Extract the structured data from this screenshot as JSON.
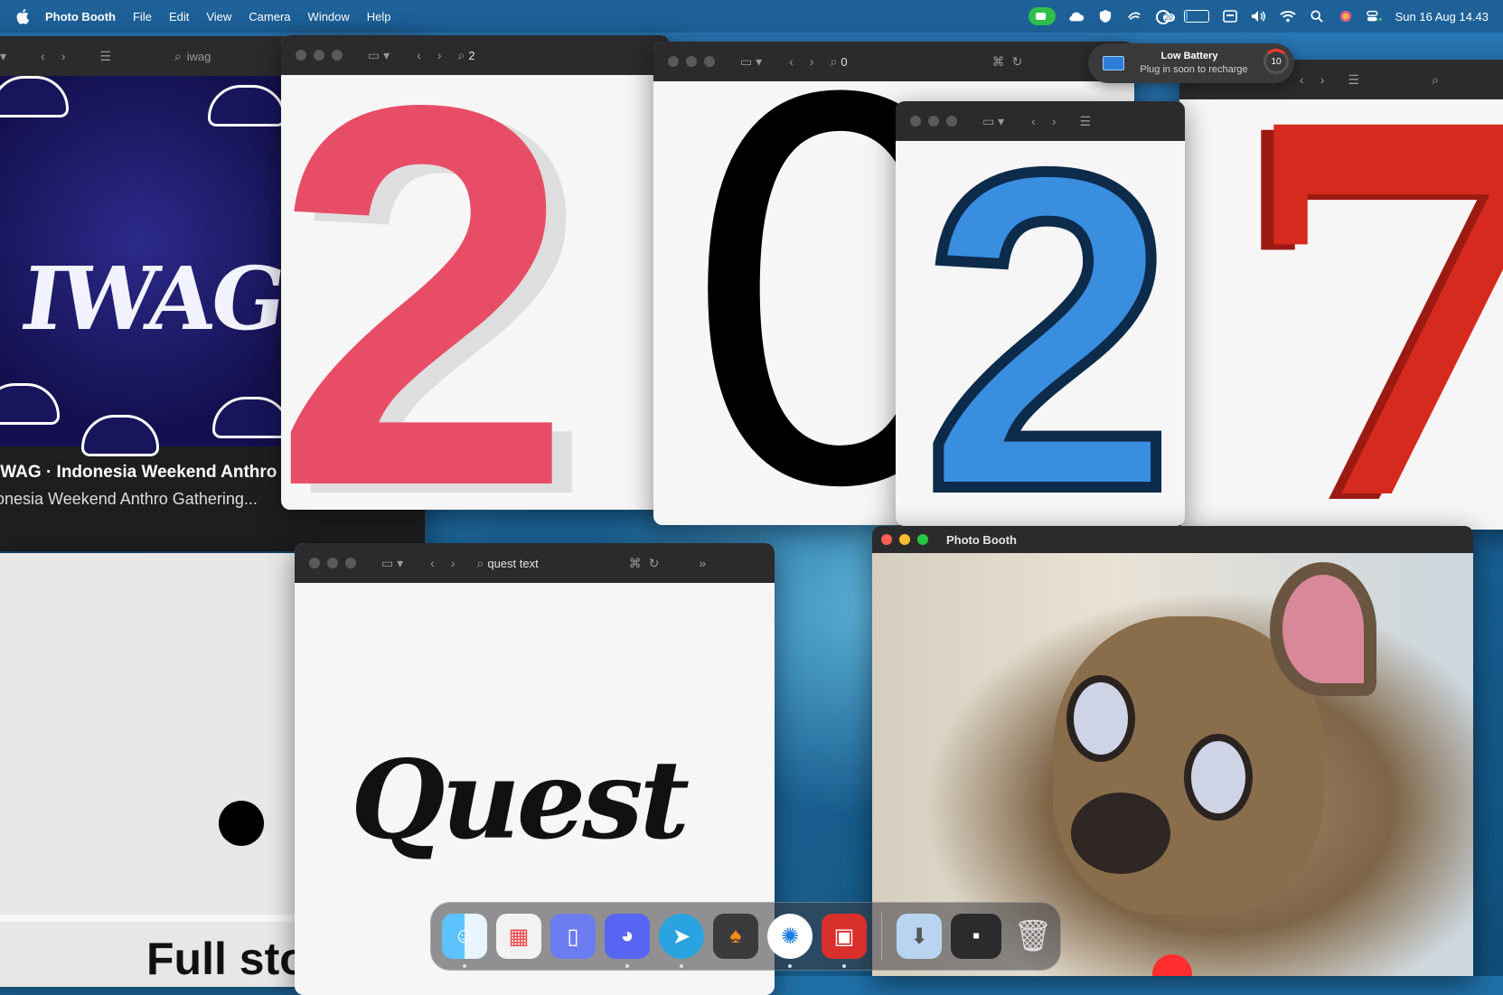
{
  "menubar": {
    "app_name": "Photo Booth",
    "menus": [
      "File",
      "Edit",
      "View",
      "Camera",
      "Window",
      "Help"
    ],
    "clock": "Sun 16 Aug  14.43",
    "notification_badge": "20",
    "battery_level": 0.1
  },
  "windows": {
    "iwag": {
      "address": "iwag",
      "title": "IWAG · Indonesia Weekend Anthro",
      "subtitle": "onesia Weekend Anthro Gathering...",
      "logo_text": "IWAG"
    },
    "digit2_red": {
      "address": "2",
      "glyph": "2",
      "color": "#e84d67"
    },
    "digit0": {
      "address": "0",
      "glyph": "0",
      "color": "#000000"
    },
    "digit2_blue": {
      "glyph": "2",
      "color": "#3a8ee0"
    },
    "digit7": {
      "glyph": "7",
      "color": "#d62a1e"
    },
    "quest": {
      "address": "quest text",
      "logo_text": "Quest"
    },
    "left_partial": {
      "text": "Full sto"
    }
  },
  "notification": {
    "title": "Low Battery",
    "body": "Plug in soon to recharge",
    "level": "10"
  },
  "photobooth": {
    "title": "Photo Booth"
  },
  "dock": {
    "apps": [
      {
        "name": "Finder",
        "icon": "finder-icon",
        "running": true
      },
      {
        "name": "Launchpad",
        "icon": "launchpad-icon",
        "running": false
      },
      {
        "name": "Simulator",
        "icon": "simulator-icon",
        "running": false
      },
      {
        "name": "Discord",
        "icon": "discord-icon",
        "running": true
      },
      {
        "name": "Telegram",
        "icon": "telegram-icon",
        "running": true
      },
      {
        "name": "FL Studio",
        "icon": "fl-studio-icon",
        "running": false
      },
      {
        "name": "Safari",
        "icon": "safari-icon",
        "running": true
      },
      {
        "name": "Photo Booth",
        "icon": "photo-booth-icon",
        "running": true
      }
    ]
  }
}
